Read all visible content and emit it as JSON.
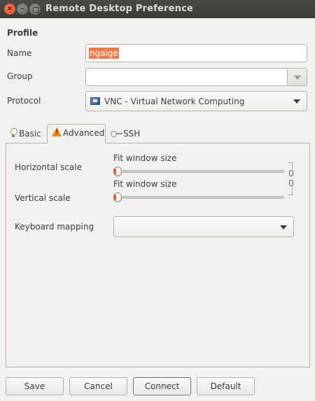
{
  "window": {
    "title": "Remote Desktop Preference",
    "controls": [
      "close-icon",
      "minimize-icon",
      "maximize-icon"
    ]
  },
  "profile": {
    "heading": "Profile",
    "name_label": "Name",
    "name_value": "ngaige",
    "group_label": "Group",
    "group_value": "",
    "protocol_label": "Protocol",
    "protocol_value": "VNC - Virtual Network Computing",
    "protocol_icon": "vnc-monitor-icon"
  },
  "tabs": {
    "basic": "Basic",
    "advanced": "Advanced",
    "ssh": "SSH",
    "active": "Advanced"
  },
  "advanced": {
    "horizontal_scale_label": "Horizontal scale",
    "horizontal_scale_caption": "Fit window size",
    "horizontal_scale_value": 0,
    "vertical_scale_label": "Vertical scale",
    "vertical_scale_caption": "Fit window size",
    "vertical_scale_value": 0,
    "keyboard_mapping_label": "Keyboard mapping",
    "keyboard_mapping_value": ""
  },
  "buttons": {
    "save": "Save",
    "cancel": "Cancel",
    "connect": "Connect",
    "default": "Default"
  },
  "colors": {
    "selection": "#f07746",
    "titlebar": "#3c3b37",
    "close_button": "#df4a16"
  }
}
